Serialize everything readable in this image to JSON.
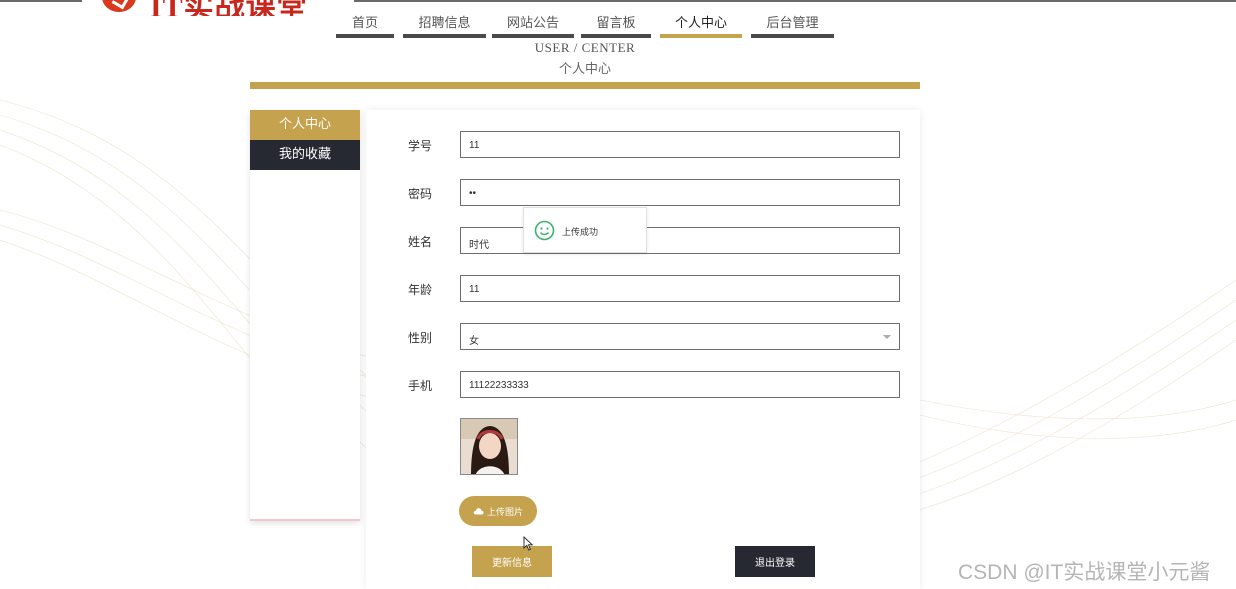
{
  "brand": {
    "logo_text": "IT实战课堂"
  },
  "nav": {
    "items": [
      {
        "label": "首页"
      },
      {
        "label": "招聘信息"
      },
      {
        "label": "网站公告"
      },
      {
        "label": "留言板"
      },
      {
        "label": "个人中心",
        "active": true
      },
      {
        "label": "后台管理"
      }
    ]
  },
  "heading": {
    "en": "USER / CENTER",
    "cn": "个人中心"
  },
  "sidebar": {
    "items": [
      {
        "label": "个人中心",
        "active": true
      },
      {
        "label": "我的收藏"
      }
    ]
  },
  "form": {
    "student_id": {
      "label": "学号",
      "value": "11"
    },
    "password": {
      "label": "密码",
      "value": "••"
    },
    "name": {
      "label": "姓名",
      "value": "时代"
    },
    "age": {
      "label": "年龄",
      "value": "11"
    },
    "gender": {
      "label": "性别",
      "value": "女"
    },
    "phone": {
      "label": "手机",
      "value": "11122233333"
    }
  },
  "upload_button": {
    "label": "上传图片"
  },
  "actions": {
    "update_label": "更新信息",
    "logout_label": "退出登录"
  },
  "toast": {
    "message": "上传成功",
    "icon": "smile-icon"
  },
  "watermark": {
    "text": "CSDN @IT实战课堂小元酱"
  },
  "colors": {
    "accent": "#c5a24e",
    "dark": "#262932",
    "nav_bar": "#4a4a4a",
    "brand_red": "#c7271c"
  }
}
